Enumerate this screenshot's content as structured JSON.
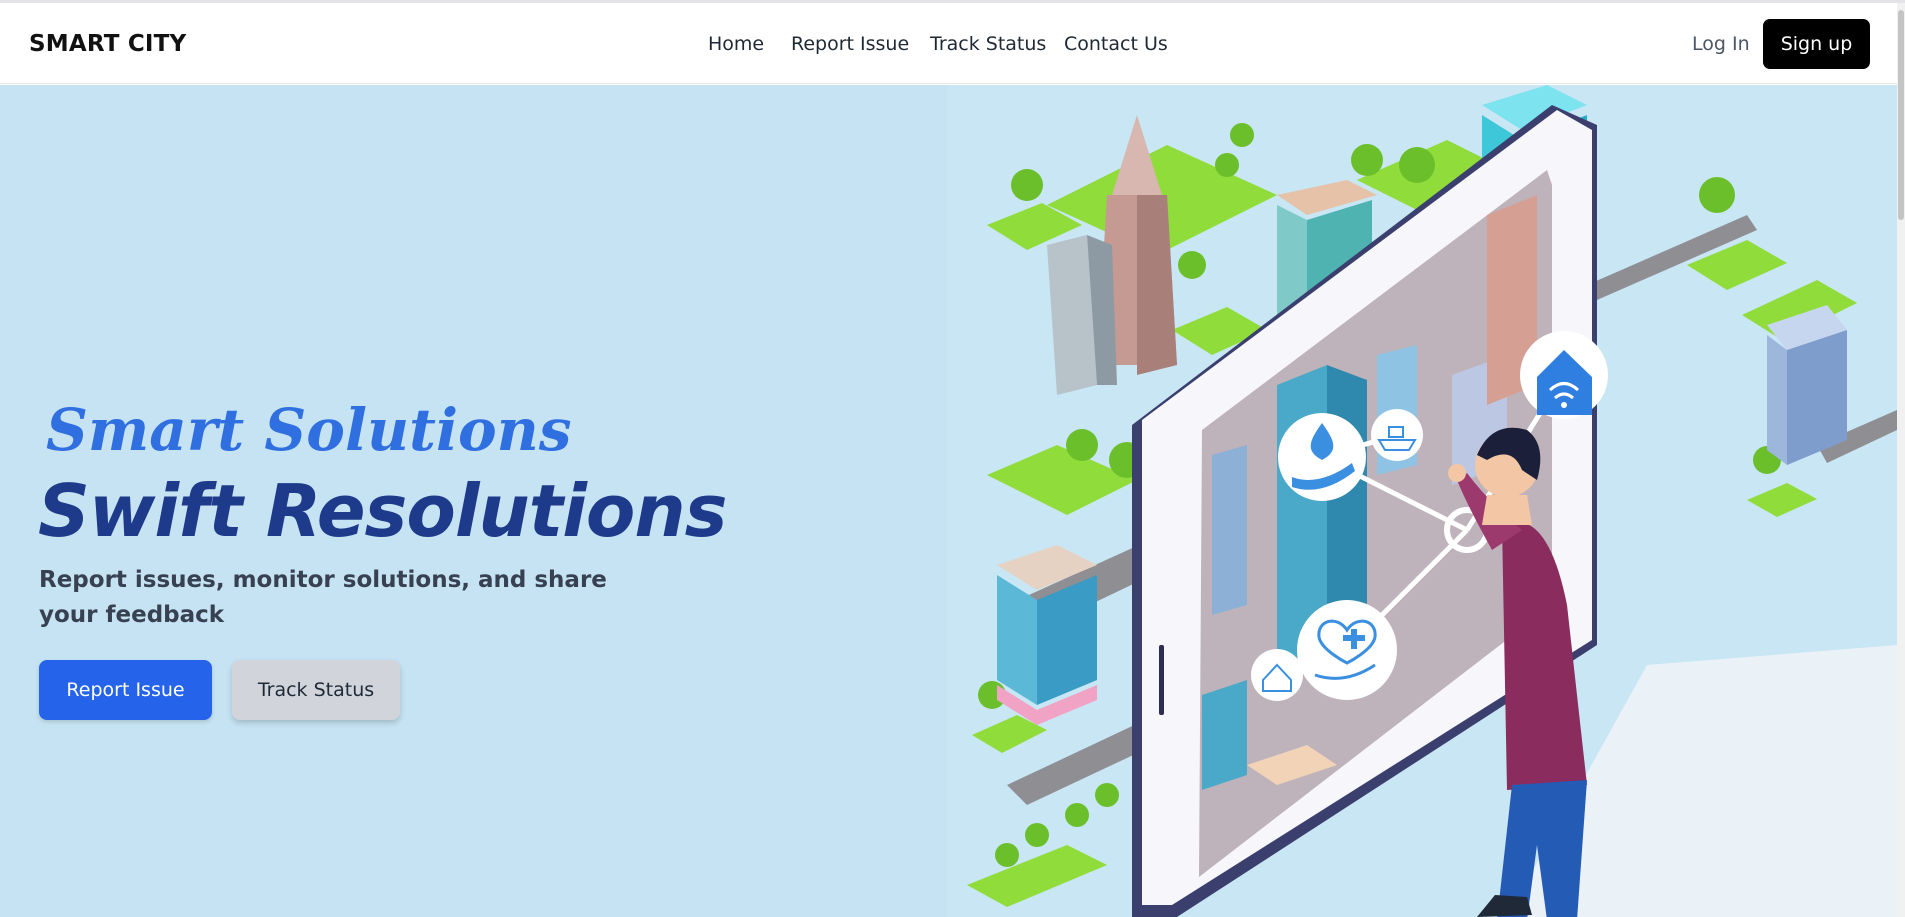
{
  "navbar": {
    "brand": "SMART CITY",
    "links": [
      {
        "label": "Home"
      },
      {
        "label": "Report Issue"
      },
      {
        "label": "Track Status"
      },
      {
        "label": "Contact Us"
      }
    ],
    "login_label": "Log In",
    "signup_label": "Sign up"
  },
  "hero": {
    "headline_1": "Smart Solutions",
    "headline_2": "Swift Resolutions",
    "subtitle": "Report issues, monitor solutions, and share your feedback",
    "primary_button": "Report Issue",
    "secondary_button": "Track Status"
  },
  "colors": {
    "hero_background": "#c6e3f3",
    "accent_blue": "#2563eb",
    "headline_dark": "#1e3a8a",
    "headline_light": "#2f6fe0"
  },
  "icons": [
    "water-drop-hand-icon",
    "wifi-home-icon",
    "health-care-hand-icon",
    "smart-home-icon",
    "ship-icon"
  ]
}
